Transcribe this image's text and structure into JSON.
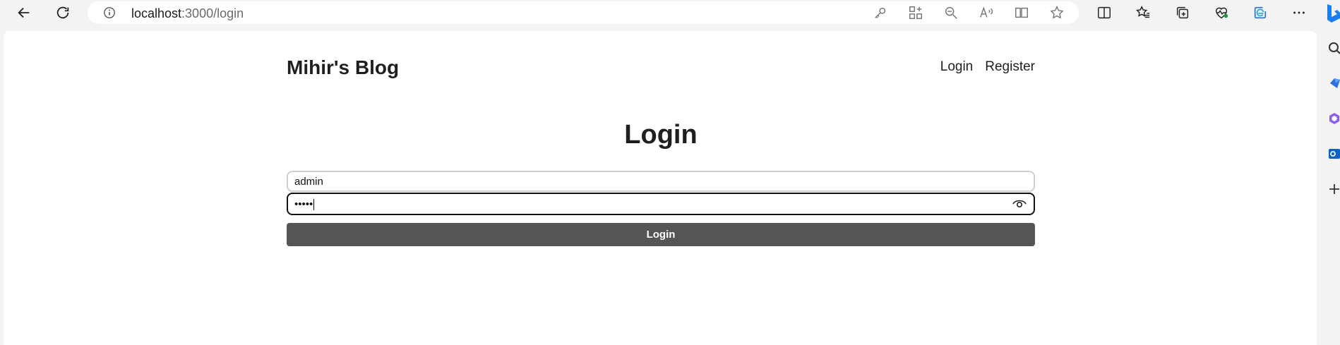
{
  "browser": {
    "url_host": "localhost",
    "url_path": ":3000/login"
  },
  "site": {
    "brand": "Mihir's Blog",
    "nav": [
      "Login",
      "Register"
    ]
  },
  "login": {
    "title": "Login",
    "username_value": "admin",
    "password_mask": "•••••",
    "submit_label": "Login"
  }
}
